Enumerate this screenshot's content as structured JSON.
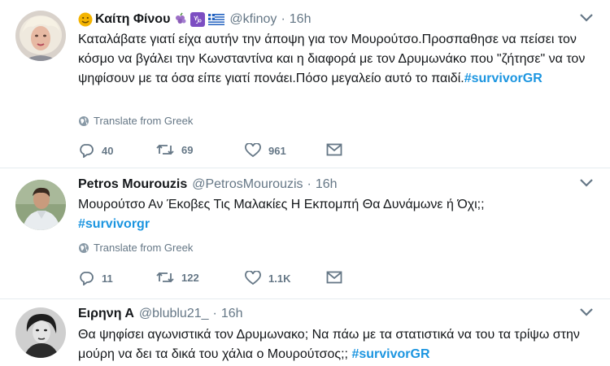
{
  "tweets": [
    {
      "name": "Καίτη Φίνου",
      "handle": "@kfinoy",
      "dot": "·",
      "time": "16h",
      "text": "Καταλάβατε γιατί είχα αυτήν την άποψη για τον Μουρούτσο.Προσπαθησε να πείσει τον κόσμο να βγάλει την Κωνσταντίνα και η διαφορά με τον Δρυμωνάκο που \"ζήτησε\" να τον ψηφίσουν με τα όσα είπε γιατί πονάει.Πόσο μεγαλείο αυτό το παιδί.",
      "hashtag": "#survivorGR",
      "translate": "Translate from Greek",
      "replies": "40",
      "retweets": "69",
      "likes": "961"
    },
    {
      "name": "Petros Mourouzis",
      "handle": "@PetrosMourouzis",
      "dot": "·",
      "time": "16h",
      "text": "Μουρούτσο Αν Έκοβες Τις Μαλακίες Η Εκπομπή Θα Δυνάμωνε ή Όχι;;",
      "hashtag": "#survivorgr",
      "translate": "Translate from Greek",
      "replies": "11",
      "retweets": "122",
      "likes": "1.1K"
    },
    {
      "name": "Ειρηνη Α",
      "handle": "@blublu21_",
      "dot": "·",
      "time": "16h",
      "text": "Θα ψηφίσει αγωνιστικά τον Δρυμωνακο; Να πάω με τα στατιστικά να του τα τρίψω στην μούρη να δει τα δικά του χάλια ο Μουρούτσος;;",
      "hashtag": "#survivorGR"
    }
  ],
  "icons": {
    "reply": "reply-icon",
    "retweet": "retweet-icon",
    "like": "heart-icon",
    "dm": "envelope-icon",
    "translate": "globe-icon",
    "caret": "chevron-down-icon"
  },
  "colors": {
    "hashtag": "#1b95e0",
    "meta": "#657786",
    "divider": "#e6ecf0"
  }
}
